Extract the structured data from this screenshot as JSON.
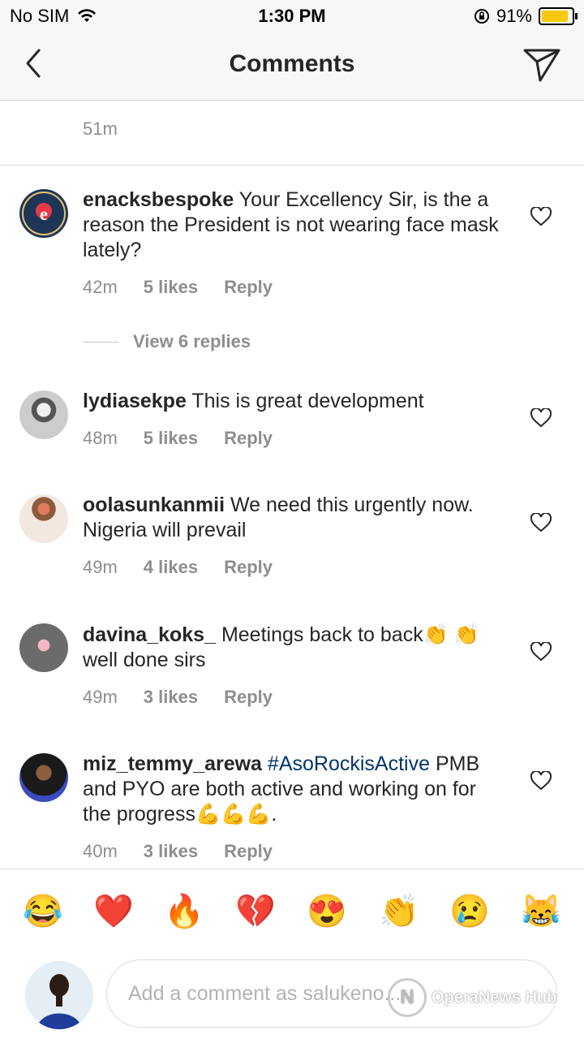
{
  "status": {
    "carrier": "No SIM",
    "time": "1:30 PM",
    "battery": "91%"
  },
  "header": {
    "title": "Comments"
  },
  "previous_comment": {
    "time": "51m"
  },
  "comments": [
    {
      "user": "enacksbespoke",
      "text": "Your Excellency Sir, is the a reason the President is not wearing face mask lately?",
      "time": "42m",
      "likes": "5 likes",
      "reply": "Reply"
    },
    {
      "user": "lydiasekpe",
      "text": "This is great development",
      "time": "48m",
      "likes": "5 likes",
      "reply": "Reply"
    },
    {
      "user": "oolasunkanmii",
      "text": "We need this urgently now. Nigeria will prevail",
      "time": "49m",
      "likes": "4 likes",
      "reply": "Reply"
    },
    {
      "user": "davina_koks_",
      "text": "Meetings back to back👏 👏well done sirs",
      "time": "49m",
      "likes": "3 likes",
      "reply": "Reply"
    },
    {
      "user": "miz_temmy_arewa",
      "tag": "#AsoRockisActive",
      "text": "PMB and PYO are both active and working on for the progress💪💪💪.",
      "time": "40m",
      "likes": "3 likes",
      "reply": "Reply"
    }
  ],
  "view_replies": "View 6 replies",
  "emoji_bar": [
    "😂",
    "❤️",
    "🔥",
    "💔",
    "😍",
    "👏",
    "😢",
    "😹"
  ],
  "composer": {
    "placeholder": "Add a comment as salukeno..."
  },
  "watermark": "OperaNews Hub"
}
